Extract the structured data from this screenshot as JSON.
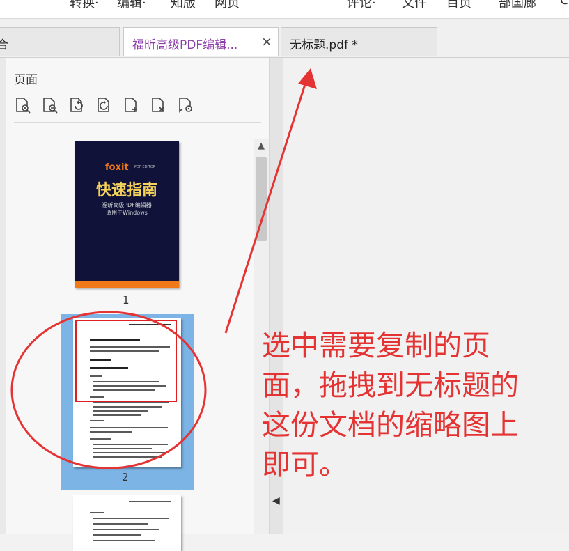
{
  "menubar": {
    "items": [
      "转换·",
      "编辑·",
      "知版",
      "网页",
      "评论·",
      "文件",
      "目页",
      "部国廊",
      "C"
    ]
  },
  "tabs": [
    {
      "label": "福昕高级PDF编辑...",
      "close": "×",
      "color": "#8b3fa8"
    },
    {
      "label": "无标题.pdf *",
      "color": "#222222"
    }
  ],
  "panel": {
    "title": "页面",
    "tools": [
      "page-zoom-in-icon",
      "page-zoom-out-icon",
      "page-rotate-left-icon",
      "page-rotate-right-icon",
      "page-insert-icon",
      "page-delete-icon",
      "page-extract-icon"
    ],
    "scroll_up": "^"
  },
  "thumbnails": {
    "page1": {
      "logo": "foxit",
      "logo_sub": "PDF EDITOR",
      "title": "快速指南",
      "sub1": "福昕高级PDF编辑器",
      "sub2": "适用于Windows",
      "number": "1"
    },
    "page2": {
      "number": "2"
    }
  },
  "main": {
    "collapse": "◀"
  },
  "annotation": {
    "lines": [
      "选中需要复制的页",
      "面，拖拽到无标题的",
      "这份文档的缩略图上",
      "即可。"
    ],
    "color": "#e53333"
  },
  "colors": {
    "selection": "#7cb4e6",
    "highlight_red": "#e02020",
    "cover_bg": "#10123a",
    "cover_accent": "#f07a1a"
  }
}
